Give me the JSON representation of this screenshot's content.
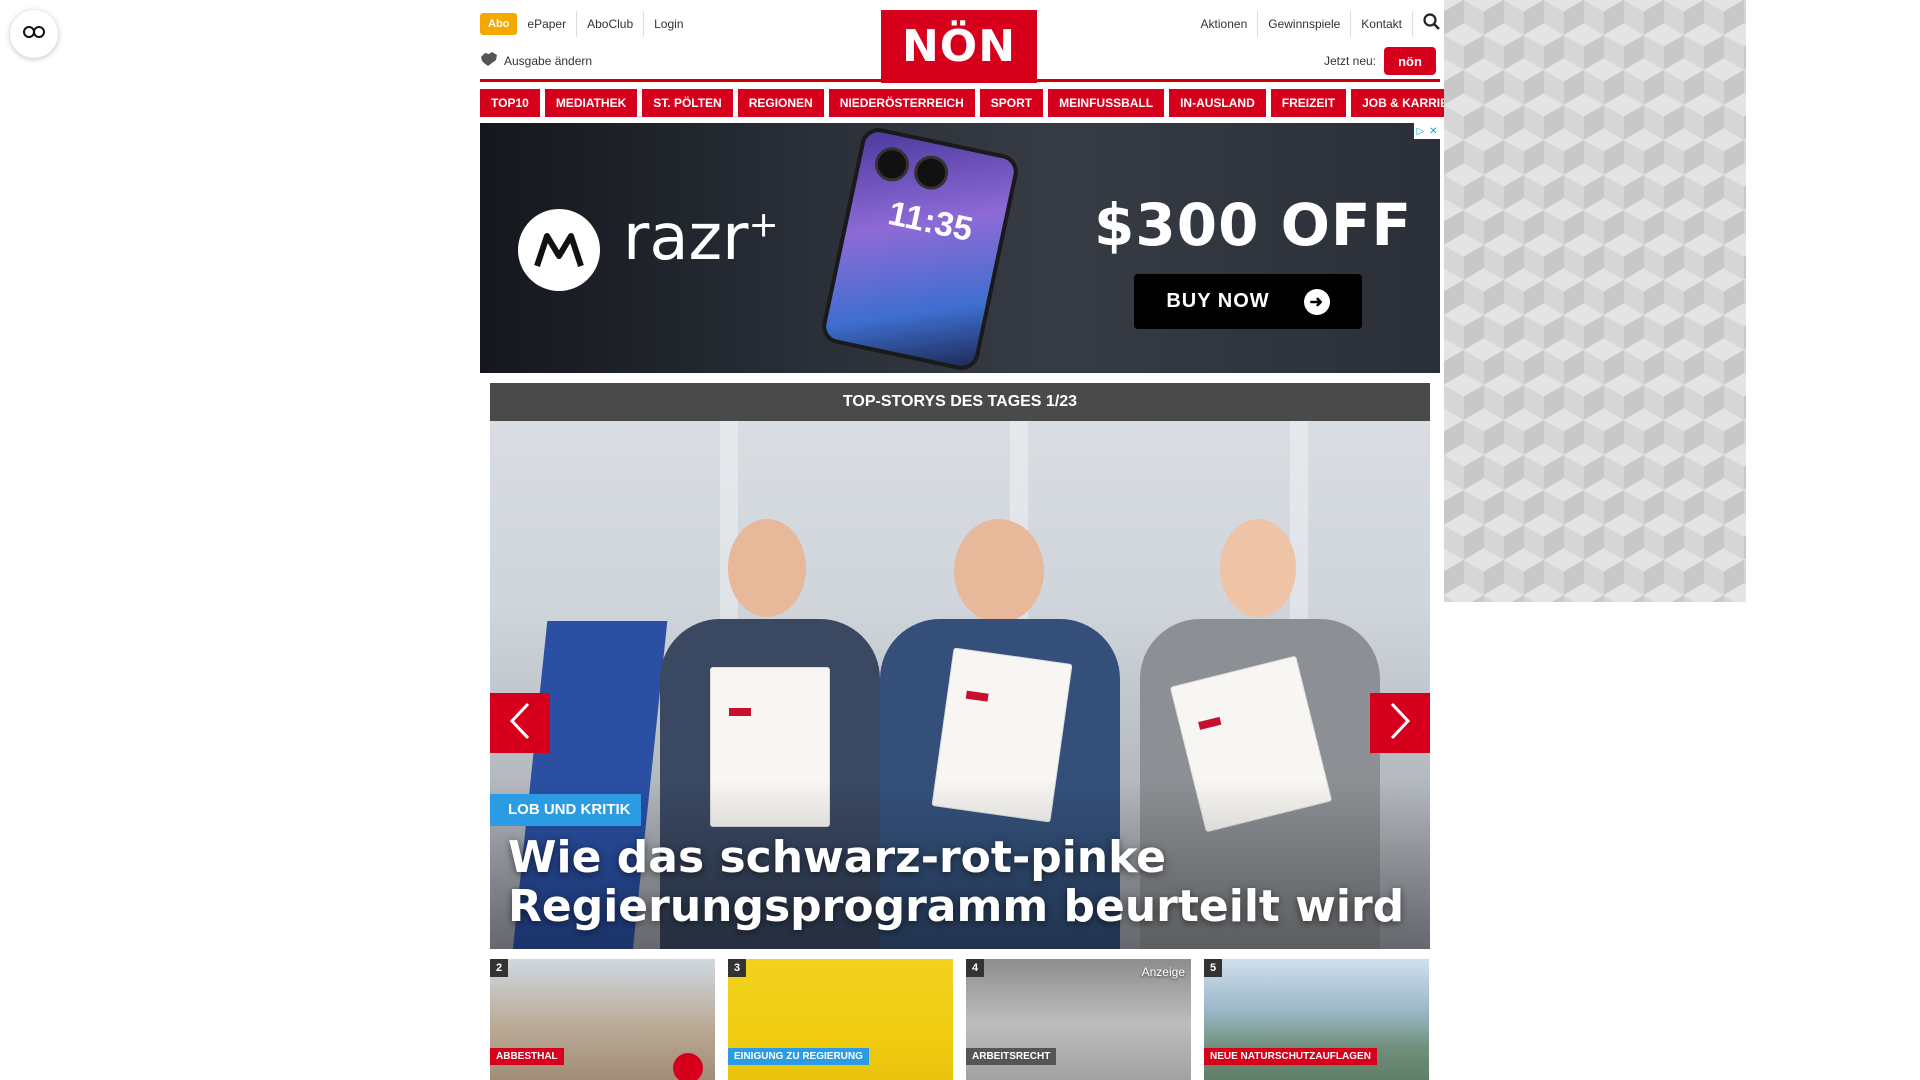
{
  "header": {
    "abo_label": "Abo",
    "links_left": [
      "ePaper",
      "AboClub",
      "Login"
    ],
    "edition_label": "Ausgabe ändern",
    "logo_text": "NÖN",
    "links_right": [
      "Aktionen",
      "Gewinnspiele",
      "Kontakt"
    ],
    "promo_label": "Jetzt neu:",
    "promo_badge": "nön",
    "search_icon": "search-icon"
  },
  "nav": {
    "items": [
      "TOP10",
      "MEDIATHEK",
      "ST. PÖLTEN",
      "REGIONEN",
      "NIEDERÖSTERREICH",
      "SPORT",
      "MEINFUSSBALL",
      "IN-AUSLAND",
      "FREIZEIT",
      "JOB & KARRIERE"
    ]
  },
  "ad": {
    "brand": "razr",
    "brand_sup": "+",
    "phone_time": "11:35",
    "offer": "$300 OFF",
    "cta": "BUY NOW",
    "adchoice_glyphs": [
      "▷",
      "✕"
    ]
  },
  "top_stories": {
    "header": "TOP-STORYS DES TAGES 1/23",
    "hero": {
      "category": "LOB UND KRITIK",
      "headline_line1": "Wie das schwarz-rot-pinke",
      "headline_line2": "Regierungsprogramm beurteilt wird"
    },
    "thumbnails": [
      {
        "num": "2",
        "category": "ABBESTHAL",
        "ad_label": ""
      },
      {
        "num": "3",
        "category": "EINIGUNG ZU REGIERUNG",
        "ad_label": ""
      },
      {
        "num": "4",
        "category": "ARBEITSRECHT",
        "ad_label": "Anzeige"
      },
      {
        "num": "5",
        "category": "NEUE NATURSCHUTZAUFLAGEN",
        "ad_label": ""
      }
    ]
  },
  "colors": {
    "brand_red": "#d6001c",
    "abo_yellow": "#f5a800",
    "tag_blue": "#2b9be3",
    "bar_grey": "#4a4a4a"
  }
}
